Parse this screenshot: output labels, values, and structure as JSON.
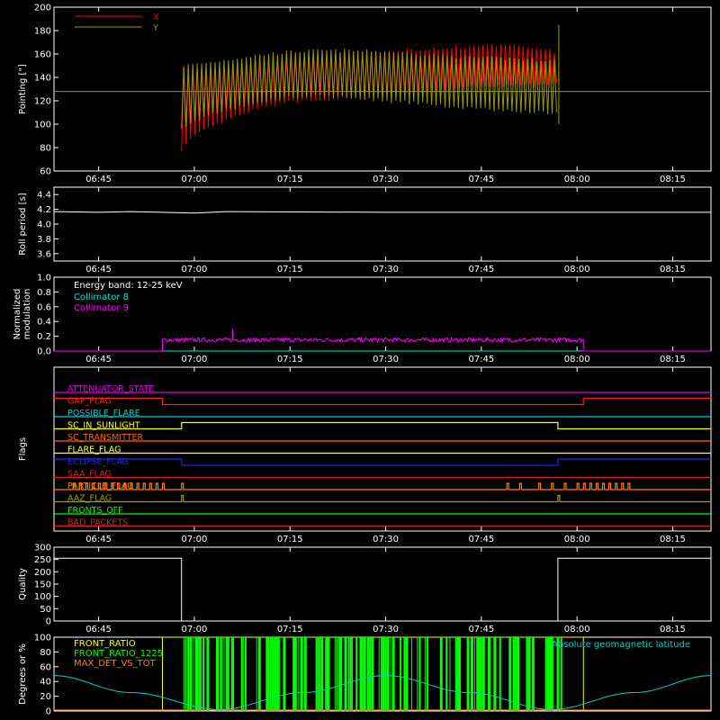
{
  "chart_data": [
    {
      "type": "line",
      "ylabel": "Pointing [\"]",
      "ylim": [
        60,
        200
      ],
      "yticks": [
        60,
        80,
        100,
        120,
        140,
        160,
        180,
        200
      ],
      "xticks": [
        "06:45",
        "07:00",
        "07:15",
        "07:30",
        "07:45",
        "08:00",
        "08:15"
      ],
      "xlim": [
        "06:38",
        "08:21"
      ],
      "legend": "top-left",
      "series": [
        {
          "name": "X",
          "color": "#ff0000",
          "x": [
            "06:58",
            "07:00",
            "07:05",
            "07:10",
            "07:15",
            "07:20",
            "07:25",
            "07:30",
            "07:35",
            "07:40",
            "07:45",
            "07:50",
            "07:55",
            "07:57"
          ],
          "upper": [
            150,
            148,
            150,
            154,
            157,
            159,
            160,
            162,
            164,
            166,
            167,
            167,
            165,
            160
          ],
          "lower": [
            78,
            90,
            103,
            113,
            119,
            121,
            123,
            125,
            127,
            130,
            132,
            133,
            133,
            134
          ]
        },
        {
          "name": "Y",
          "color": "#9a9a00",
          "x": [
            "06:58",
            "07:00",
            "07:05",
            "07:10",
            "07:15",
            "07:20",
            "07:25",
            "07:30",
            "07:35",
            "07:40",
            "07:45",
            "07:50",
            "07:55",
            "07:57"
          ],
          "upper": [
            150,
            151,
            155,
            159,
            162,
            163,
            163,
            162,
            160,
            158,
            157,
            156,
            155,
            155
          ],
          "lower": [
            95,
            103,
            112,
            118,
            123,
            124,
            122,
            120,
            118,
            115,
            113,
            111,
            110,
            110
          ],
          "baseline": 128
        }
      ]
    },
    {
      "type": "line",
      "ylabel": "Roll period [s]",
      "ylim": [
        3.5,
        4.5
      ],
      "yticks": [
        3.6,
        3.8,
        4.0,
        4.2,
        4.4
      ],
      "xticks": [
        "06:45",
        "07:00",
        "07:15",
        "07:30",
        "07:45",
        "08:00",
        "08:15"
      ],
      "series": [
        {
          "x": [
            "06:38",
            "06:45",
            "06:50",
            "06:55",
            "07:00",
            "07:05",
            "07:30",
            "08:00",
            "08:21"
          ],
          "values": [
            4.17,
            4.16,
            4.17,
            4.16,
            4.15,
            4.17,
            4.16,
            4.16,
            4.16
          ]
        }
      ]
    },
    {
      "type": "line",
      "ylabel": "Normalized modulation",
      "ylim": [
        0,
        1
      ],
      "yticks": [
        0.0,
        0.2,
        0.4,
        0.6,
        0.8,
        1.0
      ],
      "xticks": [
        "06:45",
        "07:00",
        "07:15",
        "07:30",
        "07:45",
        "08:00",
        "08:15"
      ],
      "annotation": "Energy band: 12-25 keV",
      "series": [
        {
          "name": "Collimator 8",
          "color": "#00e5e5",
          "values": [
            0
          ]
        },
        {
          "name": "Collimator 9",
          "color": "#ff00ff",
          "x_start": "06:55",
          "x_end": "08:01",
          "values": [
            0.15,
            0.15
          ],
          "noise": 0.03
        }
      ]
    },
    {
      "type": "line",
      "ylabel": "Flags",
      "xticks": [
        "06:45",
        "07:00",
        "07:15",
        "07:30",
        "07:45",
        "08:00",
        "08:15"
      ],
      "series": [
        {
          "name": "ATTENUATOR_STATE",
          "color": "#e000e0"
        },
        {
          "name": "GAP_FLAG",
          "color": "#ff2020",
          "high_x": [
            "08:01",
            "08:21"
          ],
          "low_x": [
            "06:55",
            "08:01"
          ]
        },
        {
          "name": "POSSIBLE_FLARE",
          "color": "#00d0d0"
        },
        {
          "name": "SC_IN_SUNLIGHT",
          "color": "#ffff00",
          "low_x": [
            "06:38",
            "06:58"
          ],
          "low_x2": [
            "07:57",
            "08:21"
          ]
        },
        {
          "name": "SC_TRANSMITTER",
          "color": "#ff6000"
        },
        {
          "name": "FLARE_FLAG",
          "color": "#ffff40"
        },
        {
          "name": "ECLIPSE_FLAG",
          "color": "#2020ff",
          "low_x": [
            "06:58",
            "07:57"
          ]
        },
        {
          "name": "SAA_FLAG",
          "color": "#e02020"
        },
        {
          "name": "PARTICLE_FLAG",
          "color": "#ff8000",
          "pulses": [
            "06:41",
            "06:42",
            "06:43",
            "06:44",
            "06:45",
            "06:46",
            "06:47",
            "06:48",
            "06:49",
            "06:50",
            "06:51",
            "06:52",
            "06:53",
            "06:54",
            "06:55",
            "06:58",
            "07:49",
            "07:51",
            "07:54",
            "07:56",
            "07:58",
            "08:00",
            "08:01",
            "08:02",
            "08:03",
            "08:04",
            "08:05",
            "08:06",
            "08:07",
            "08:08"
          ]
        },
        {
          "name": "AAZ_FLAG",
          "color": "#a0a000",
          "pulses": [
            "06:58",
            "07:57"
          ]
        },
        {
          "name": "FRONTS_OFF",
          "color": "#00ff00"
        },
        {
          "name": "BAD_PACKETS",
          "color": "#e02020"
        }
      ]
    },
    {
      "type": "line",
      "ylabel": "Quality",
      "ylim": [
        0,
        300
      ],
      "yticks": [
        0,
        50,
        100,
        150,
        200,
        250,
        300
      ],
      "xticks": [
        "06:45",
        "07:00",
        "07:15",
        "07:30",
        "07:45",
        "08:00",
        "08:15"
      ],
      "series": [
        {
          "x": [
            "06:38",
            "06:58",
            "06:58",
            "07:57",
            "07:57",
            "08:21"
          ],
          "values": [
            255,
            255,
            0,
            0,
            255,
            255
          ]
        }
      ]
    },
    {
      "type": "line",
      "ylabel": "Degrees or %",
      "ylim": [
        0,
        100
      ],
      "yticks": [
        0,
        20,
        40,
        60,
        80,
        100
      ],
      "xticks": [
        "06:45",
        "07:00",
        "07:15",
        "07:30",
        "07:45",
        "08:00",
        "08:15"
      ],
      "legend": "top-left",
      "series": [
        {
          "name": "FRONT_RATIO",
          "color": "#ffff00",
          "x_start": "06:55",
          "x_end": "08:01",
          "values": [
            100,
            100
          ]
        },
        {
          "name": "FRONT_RATIO_1225",
          "color": "#00ff00",
          "x_start": "06:58",
          "x_end": "07:58",
          "values": [
            100,
            0
          ]
        },
        {
          "name": "MAX_DET_VS_TOT",
          "color": "#ff8000",
          "values": [
            0
          ]
        },
        {
          "name": "Absolute geomagnetic latitude",
          "color": "#00d0d0",
          "x": [
            "06:38",
            "06:50",
            "07:04",
            "07:17",
            "07:30",
            "07:43",
            "07:56",
            "08:09",
            "08:21"
          ],
          "values": [
            48,
            25,
            2,
            25,
            48,
            25,
            2,
            25,
            48
          ]
        }
      ]
    }
  ]
}
